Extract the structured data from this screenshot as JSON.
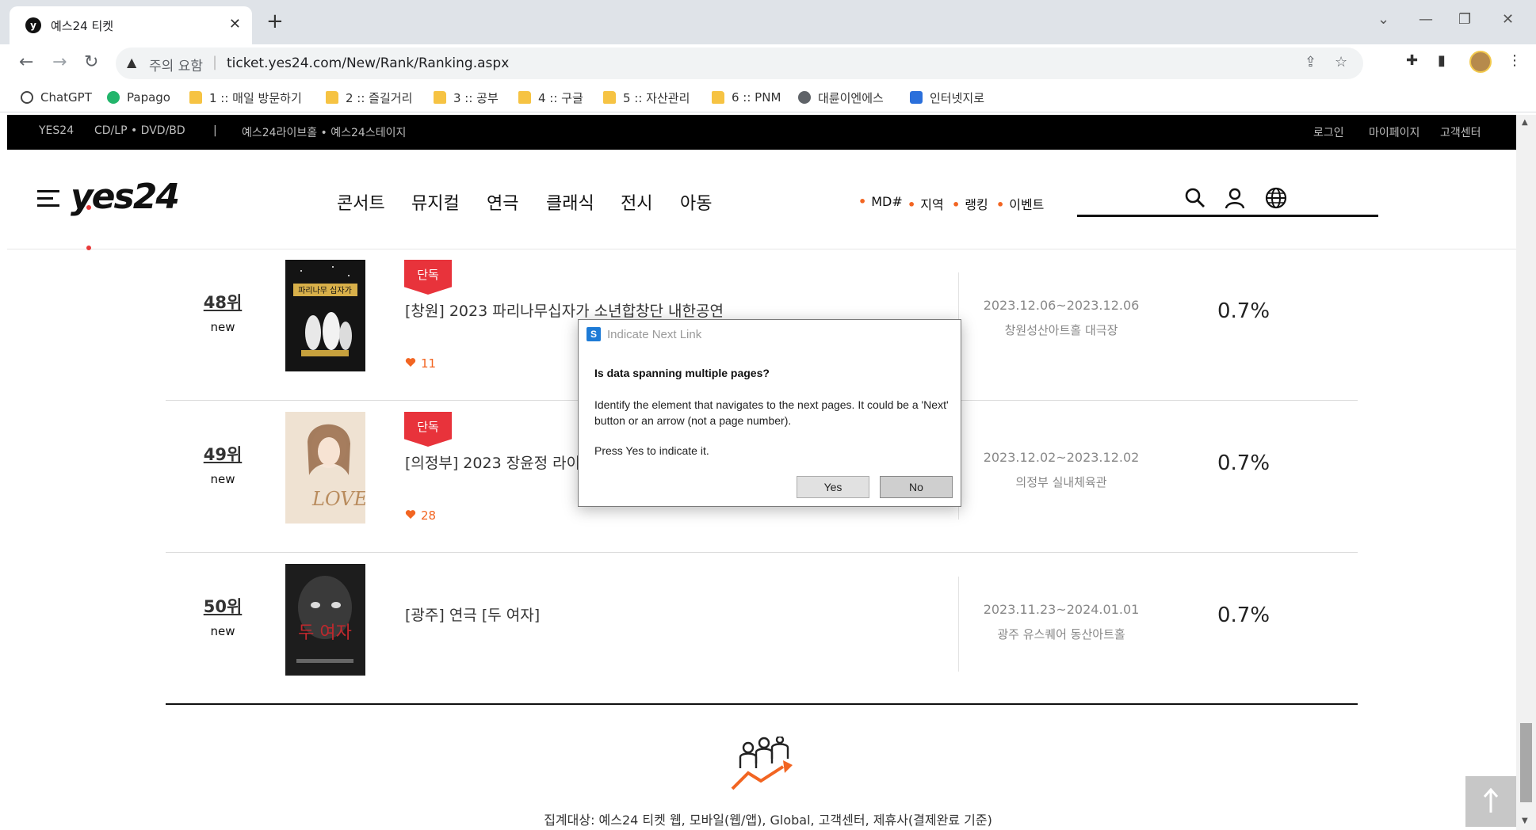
{
  "browser": {
    "tab_title": "예스24 티켓",
    "tab_favicon": "y",
    "new_tab": "+",
    "url_warning": "주의 요함",
    "url": "ticket.yes24.com/New/Rank/Ranking.aspx",
    "bookmarks": [
      "ChatGPT",
      "Papago",
      "1 :: 매일 방문하기",
      "2 :: 즐길거리",
      "3 :: 공부",
      "4 :: 구글",
      "5 :: 자산관리",
      "6 :: PNM",
      "대륜이엔에스",
      "인터넷지로"
    ]
  },
  "site_top": {
    "left_links": [
      "YES24",
      "CD/LP • DVD/BD",
      "|",
      "예스24라이브홀 • 예스24스테이지"
    ],
    "right_links": [
      "로그인",
      "마이페이지",
      "고객센터"
    ]
  },
  "header": {
    "logo": "yes24",
    "categories": [
      "콘서트",
      "뮤지컬",
      "연극",
      "클래식",
      "전시",
      "아동"
    ],
    "sub_links": [
      "MD#",
      "지역",
      "랭킹",
      "이벤트"
    ]
  },
  "rankings": [
    {
      "rank": "48위",
      "status": "new",
      "badge": "단독",
      "title": "[창원] 2023 파리나무십자가 소년합창단 내한공연",
      "likes": "11",
      "period": "2023.12.06~2023.12.06",
      "venue": "창원성산아트홀 대극장",
      "share": "0.7%",
      "poster": {
        "bg": "#141414",
        "accent": "#d8b04a",
        "text": "파리나무 십자가"
      }
    },
    {
      "rank": "49위",
      "status": "new",
      "badge": "단독",
      "title": "[의정부] 2023 장윤정 라이",
      "likes": "28",
      "period": "2023.12.02~2023.12.02",
      "venue": "의정부 실내체육관",
      "share": "0.7%",
      "poster": {
        "bg": "#efe2d2",
        "accent": "#b98c5e",
        "text": "LOVE"
      }
    },
    {
      "rank": "50위",
      "status": "new",
      "badge": "",
      "title": "[광주] 연극 [두 여자]",
      "likes": "",
      "period": "2023.11.23~2024.01.01",
      "venue": "광주 유스퀘어 동산아트홀",
      "share": "0.7%",
      "poster": {
        "bg": "#1d1d1d",
        "accent": "#c0282d",
        "text": "두 여자"
      }
    }
  ],
  "footer": {
    "aggregation_note": "집계대상: 예스24 티켓 웹, 모바일(웹/앱), Global, 고객센터, 제휴사(결제완료 기준)"
  },
  "dialog": {
    "title": "Indicate Next Link",
    "question": "Is data spanning multiple pages?",
    "body": "Identify the element that navigates to the next pages. It could be a 'Next' button or an arrow (not a page number).",
    "body2": "Press Yes to indicate it.",
    "yes": "Yes",
    "no": "No"
  },
  "colors": {
    "accent_orange": "#f26522",
    "badge_red": "#e8333b",
    "top_strip": "#000000"
  },
  "icons": [
    "back-icon",
    "forward-icon",
    "reload-icon",
    "warning-icon",
    "share-icon",
    "star-icon",
    "extension-icon",
    "sidepanel-icon",
    "menu-icon",
    "hamburger-icon",
    "search-icon",
    "user-icon",
    "globe-icon",
    "heart-icon",
    "arrow-up-icon",
    "stats-icon"
  ]
}
